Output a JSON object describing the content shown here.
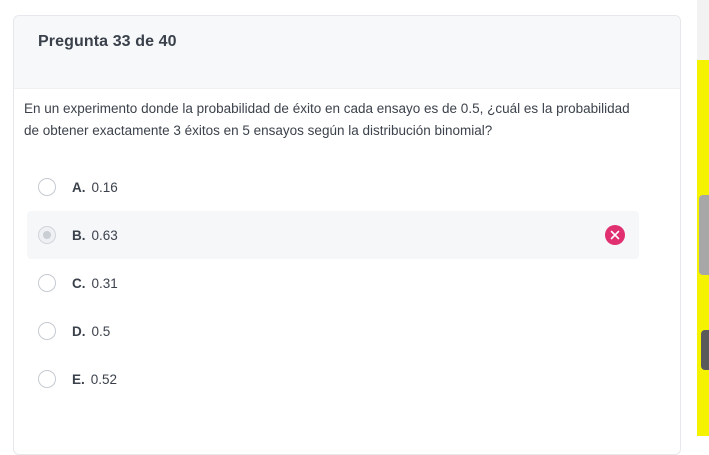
{
  "header": {
    "title": "Pregunta 33 de 40"
  },
  "question": {
    "text": "En un experimento donde la probabilidad de éxito en cada ensayo es de 0.5, ¿cuál es la probabilidad de obtener exactamente 3 éxitos en 5 ensayos según la distribución binomial?"
  },
  "options": [
    {
      "letter": "A.",
      "value": "0.16",
      "selected": false
    },
    {
      "letter": "B.",
      "value": "0.63",
      "selected": true,
      "status": "incorrect"
    },
    {
      "letter": "C.",
      "value": "0.31",
      "selected": false
    },
    {
      "letter": "D.",
      "value": "0.5",
      "selected": false
    },
    {
      "letter": "E.",
      "value": "0.52",
      "selected": false
    }
  ],
  "colors": {
    "incorrect": "#e0306f",
    "header_bg": "#f7f8fa",
    "accent_yellow": "#f5f200"
  },
  "icons": {
    "incorrect": "close-circle-icon"
  }
}
